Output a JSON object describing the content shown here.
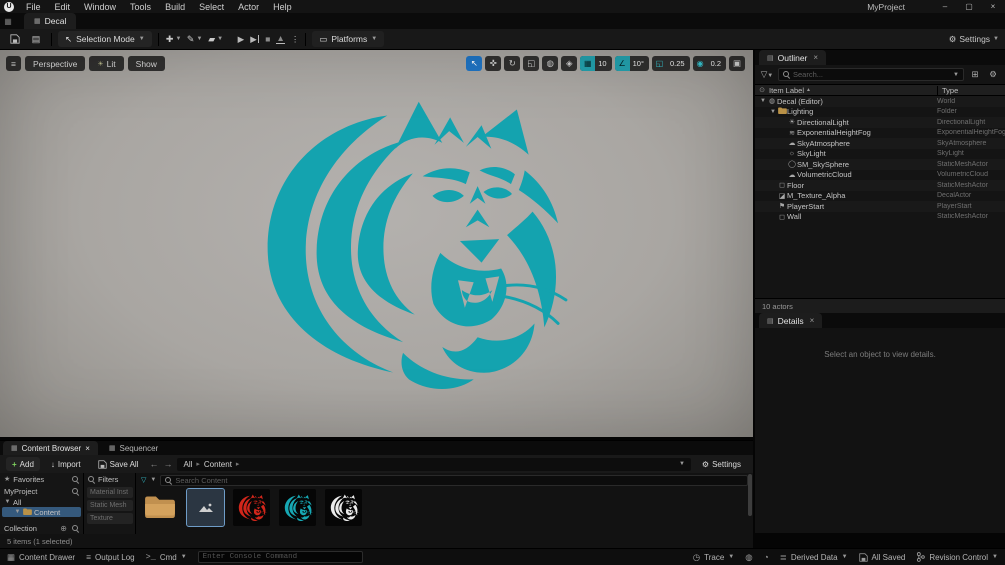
{
  "window": {
    "project": "MyProject"
  },
  "menu_bar": {
    "items": [
      "File",
      "Edit",
      "Window",
      "Tools",
      "Build",
      "Select",
      "Actor",
      "Help"
    ]
  },
  "editor_tab": {
    "label": "Decal"
  },
  "main_toolbar": {
    "selection_mode": "Selection Mode",
    "platforms": "Platforms",
    "settings": "Settings"
  },
  "viewport": {
    "buttons": [
      {
        "label": "Perspective"
      },
      {
        "label": "Lit"
      },
      {
        "label": "Show"
      }
    ],
    "tools": [
      {
        "icon": "cursor",
        "active": true
      },
      {
        "icon": "move",
        "active": false
      },
      {
        "icon": "rotate",
        "active": false
      },
      {
        "icon": "scale",
        "active": false
      },
      {
        "icon": "globe",
        "active": false
      },
      {
        "icon": "magnet",
        "active": false
      }
    ],
    "snap_chips": [
      {
        "icon": "grid",
        "label": "10",
        "active": true
      },
      {
        "icon": "angle",
        "label": "10°",
        "active": true
      },
      {
        "icon": "scale",
        "label": "0.25",
        "active": false
      },
      {
        "icon": "camera",
        "label": "0.2",
        "active": false
      }
    ],
    "tiger_color": "#14a3af"
  },
  "outliner": {
    "title": "Outliner",
    "search_placeholder": "Search...",
    "columns": {
      "label": "Item Label",
      "type": "Type"
    },
    "rows": [
      {
        "label": "Decal (Editor)",
        "type": "World",
        "icon": "world",
        "indent": 0,
        "caret": true
      },
      {
        "label": "Lighting",
        "type": "Folder",
        "icon": "folder",
        "indent": 1,
        "caret": true
      },
      {
        "label": "DirectionalLight",
        "type": "DirectionalLight",
        "icon": "sun",
        "indent": 2,
        "caret": false
      },
      {
        "label": "ExponentialHeightFog",
        "type": "ExponentialHeightFog",
        "icon": "fog",
        "indent": 2,
        "caret": false
      },
      {
        "label": "SkyAtmosphere",
        "type": "SkyAtmosphere",
        "icon": "cloud",
        "indent": 2,
        "caret": false
      },
      {
        "label": "SkyLight",
        "type": "SkyLight",
        "icon": "skylight",
        "indent": 2,
        "caret": false
      },
      {
        "label": "SM_SkySphere",
        "type": "StaticMeshActor",
        "icon": "sphere",
        "indent": 2,
        "caret": false
      },
      {
        "label": "VolumetricCloud",
        "type": "VolumetricCloud",
        "icon": "cloud",
        "indent": 2,
        "caret": false
      },
      {
        "label": "Floor",
        "type": "StaticMeshActor",
        "icon": "cube",
        "indent": 1,
        "caret": false
      },
      {
        "label": "M_Texture_Alpha",
        "type": "DecalActor",
        "icon": "decal",
        "indent": 1,
        "caret": false
      },
      {
        "label": "PlayerStart",
        "type": "PlayerStart",
        "icon": "player",
        "indent": 1,
        "caret": false
      },
      {
        "label": "Wall",
        "type": "StaticMeshActor",
        "icon": "cube",
        "indent": 1,
        "caret": false
      }
    ],
    "footer": "10 actors"
  },
  "details": {
    "title": "Details",
    "empty_message": "Select an object to view details."
  },
  "content_browser": {
    "tabs": [
      {
        "label": "Content Browser",
        "active": true
      },
      {
        "label": "Sequencer",
        "active": false
      }
    ],
    "toolbar": {
      "add": "Add",
      "import": "Import",
      "save_all": "Save All",
      "settings": "Settings"
    },
    "breadcrumb": [
      "All",
      "Content"
    ],
    "left": {
      "favorites": "Favorites",
      "project": "MyProject",
      "tree": [
        {
          "label": "All",
          "indent": 0,
          "selected": false,
          "icon": ""
        },
        {
          "label": "Content",
          "indent": 1,
          "selected": true,
          "icon": "folder"
        }
      ],
      "collection": "Collection"
    },
    "filters": {
      "label": "Filters",
      "chips": [
        "Material Inst",
        "Static Mesh",
        "Texture"
      ]
    },
    "search_placeholder": "Search Content",
    "assets": [
      {
        "kind": "folder",
        "selected": false,
        "color": "#c79455"
      },
      {
        "kind": "texture",
        "selected": true,
        "color": "#2b2b2b"
      },
      {
        "kind": "tiger",
        "selected": false,
        "color": "#d2261b"
      },
      {
        "kind": "tiger",
        "selected": false,
        "color": "#17a8b4"
      },
      {
        "kind": "tiger",
        "selected": false,
        "color": "#ebebeb"
      }
    ],
    "status": "5 items (1 selected)"
  },
  "status_bar": {
    "content_drawer": "Content Drawer",
    "output_log": "Output Log",
    "cmd": "Cmd",
    "console_placeholder": "Enter Console Command",
    "trace": "Trace",
    "derived_data": "Derived Data",
    "all_saved": "All Saved",
    "revision_control": "Revision Control"
  }
}
